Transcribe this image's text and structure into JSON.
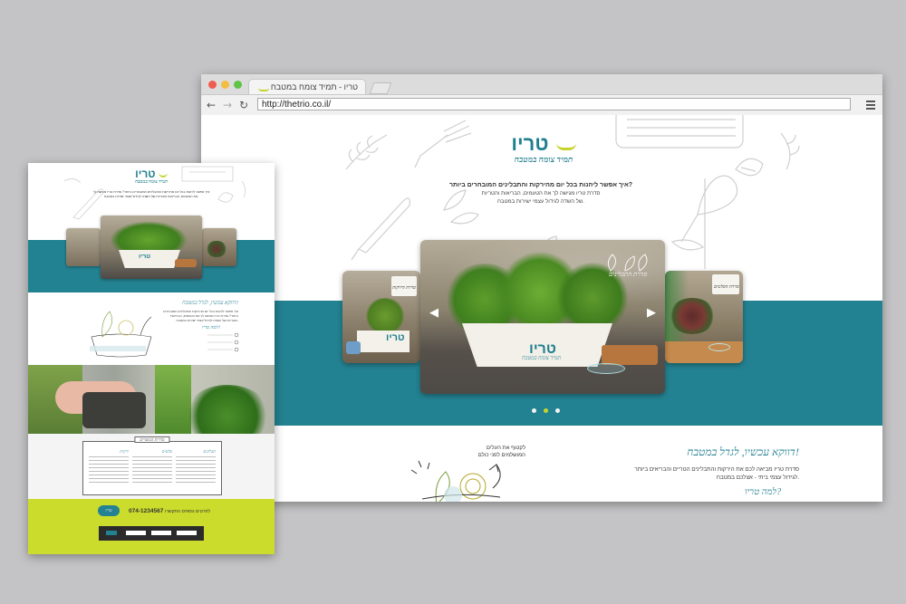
{
  "browser": {
    "tab_title": "טריו - תמיד צומח במטבח",
    "url": "http://thetrio.co.il/",
    "nav": {
      "back": "←",
      "forward": "→",
      "reload": "↻"
    }
  },
  "site": {
    "logo_text": "טריו",
    "tagline": "תמיד צומח במטבח",
    "intro_heading": "איך אפשר ליהנות בכל יום מהירקות והתבלינים המובחרים ביותר?",
    "intro_lines": [
      "סדרת טריו מגישה לך את הטעמים, הבריאות והטריות",
      "של השדה לגידול עצמי ישירות במטבח."
    ],
    "slider": {
      "prev": "◀",
      "next": "▶",
      "main_label": "סדרת התבלינים",
      "left_label": "סדרת הירקות",
      "right_label": "סדרת הסלטים",
      "active_dot": 1
    },
    "lower": {
      "title": "דווקא עכשיו, לגדל במטבח!",
      "text": "סדרת טריו מביאה לכם את הירקות והתבלינים הטריים והבריאים ביותר לגידול עצמי ביתי - אצלכם במטבח.",
      "subtitle": "למה טריו?",
      "quote": "לקטוף את העלים המושלמים לפני כולם"
    }
  },
  "mini_page": {
    "logo_text": "טריו",
    "tagline": "תמיד צומח במטבח",
    "intro": "איך אפשר ליהנות בכל יום מהירקות והתבלינים המובחרים ביותר? סדרת טריו מגישה לך את הטעמים, הבריאות והטריות של השדה לגידול עצמי ישירות במטבח.",
    "section_title": "דווקא עכשיו, לגדל במטבח!",
    "section_sub": "למה טריו?",
    "card_title": "סדרות המוצרים",
    "columns": [
      "ירקות",
      "סלטים",
      "תבלינים"
    ],
    "phone": "074-1234567",
    "phone_label": "לפרטים נוספים התקשרו",
    "badge": "טריו"
  },
  "colors": {
    "teal": "#238291",
    "lime": "#cbdc2c",
    "text": "#333333"
  }
}
